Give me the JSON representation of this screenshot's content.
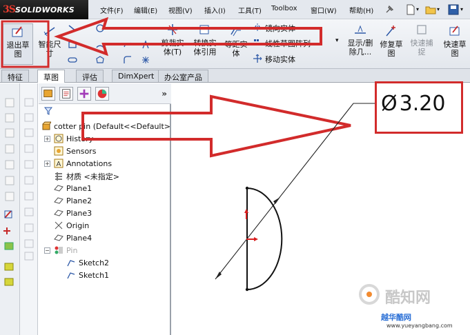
{
  "app": {
    "logo_mark": "3S",
    "logo_text": "SOLIDWORKS"
  },
  "menu": {
    "file": "文件(F)",
    "edit": "编辑(E)",
    "view": "视图(V)",
    "insert": "插入(I)",
    "tools": "工具(T)",
    "toolbox": "Toolbox",
    "window": "窗口(W)",
    "help": "帮助(H)"
  },
  "toolbar": {
    "exit_sketch_line1": "退出草",
    "exit_sketch_line2": "图",
    "smart_dim_line1": "智能尺",
    "smart_dim_line2": "寸",
    "trim_line1": "剪裁实",
    "trim_line2": "体(T)",
    "convert_line1": "转换实",
    "convert_line2": "体引用",
    "offset_line1": "等距实",
    "offset_line2": "体",
    "mirror": "镜向实体",
    "linear_pattern": "线性草图阵列",
    "move": "移动实体",
    "show_delete_line1": "显示/删",
    "show_delete_line2": "除几...",
    "repair_line1": "修复草",
    "repair_line2": "图",
    "rapid_snap_line1": "快速捕",
    "rapid_snap_line2": "捉",
    "rapid_sketch_line1": "快速草",
    "rapid_sketch_line2": "图"
  },
  "tabs": [
    "特征",
    "草图",
    "评估",
    "DimXpert",
    "办公室产品"
  ],
  "active_tab": "草图",
  "feature_tree": {
    "root": "cotter pin  (Default<<Default>",
    "items": [
      "History",
      "Sensors",
      "Annotations",
      "材质 <未指定>",
      "Plane1",
      "Plane2",
      "Plane3",
      "Origin",
      "Plane4",
      "Pin",
      "Sketch2",
      "Sketch1"
    ]
  },
  "dimension": {
    "symbol": "Ø",
    "value": "3.20"
  },
  "watermark": {
    "brand": "酷知网",
    "site_cn": "越华酷网",
    "site_url": "www.yueyangbang.com"
  },
  "colors": {
    "annotation_red": "#d22b2b",
    "origin_red": "#d81e1e",
    "sketch_black": "#111111"
  }
}
